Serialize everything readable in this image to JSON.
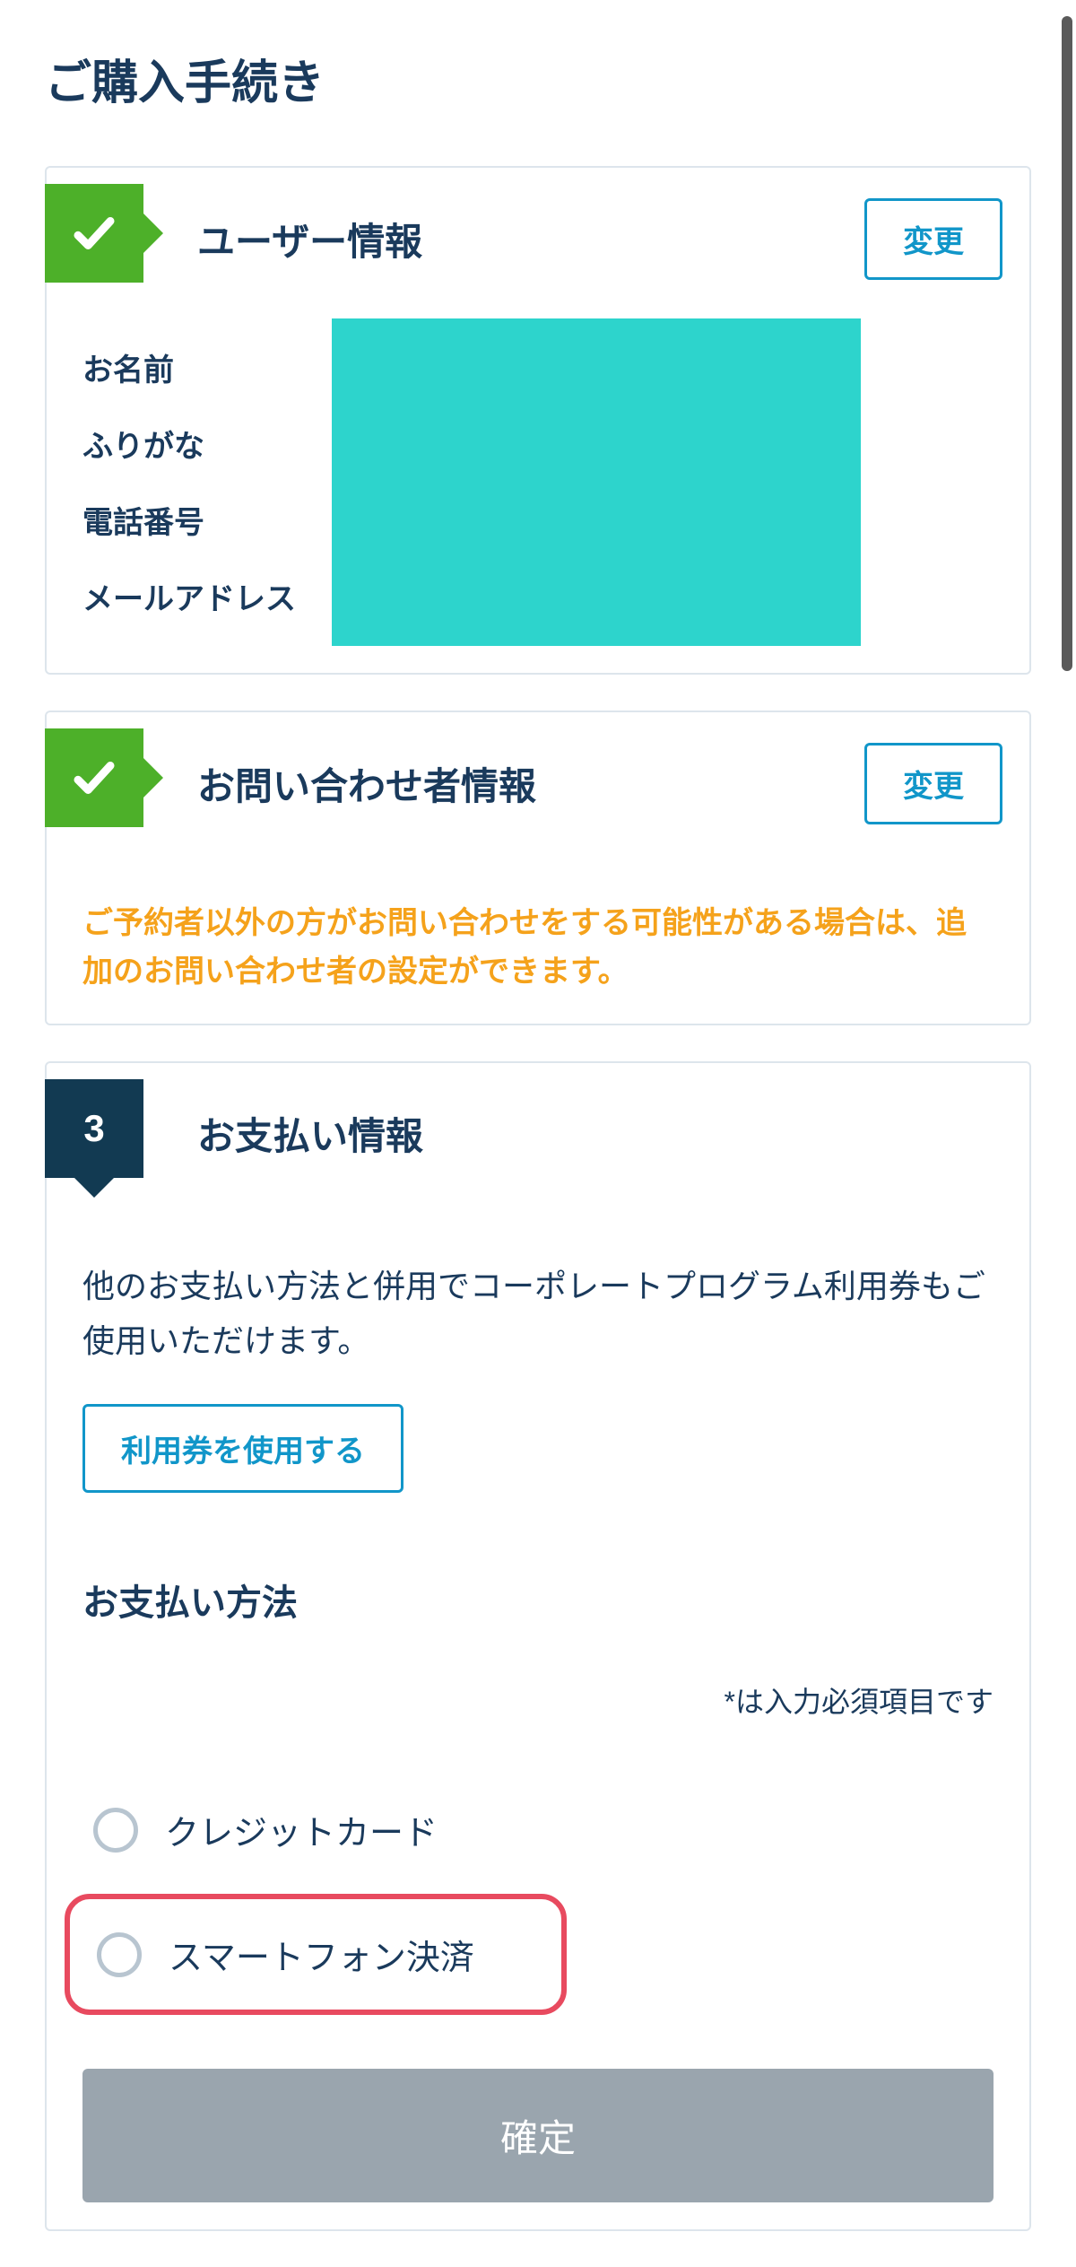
{
  "page_title": "ご購入手続き",
  "sections": {
    "user_info": {
      "title": "ユーザー情報",
      "change_label": "変更",
      "fields": {
        "name": "お名前",
        "furigana": "ふりがな",
        "phone": "電話番号",
        "email": "メールアドレス"
      }
    },
    "inquirer_info": {
      "title": "お問い合わせ者情報",
      "change_label": "変更",
      "notice": "ご予約者以外の方がお問い合わせをする可能性がある場合は、追加のお問い合わせ者の設定ができます。"
    },
    "payment": {
      "step_number": "3",
      "title": "お支払い情報",
      "description": "他のお支払い方法と併用でコーポレートプログラム利用券もご使用いただけます。",
      "voucher_label": "利用券を使用する",
      "method_heading": "お支払い方法",
      "required_note": "*は入力必須項目です",
      "options": {
        "credit_card": "クレジットカード",
        "smartphone": "スマートフォン決済"
      },
      "confirm_label": "確定"
    }
  }
}
